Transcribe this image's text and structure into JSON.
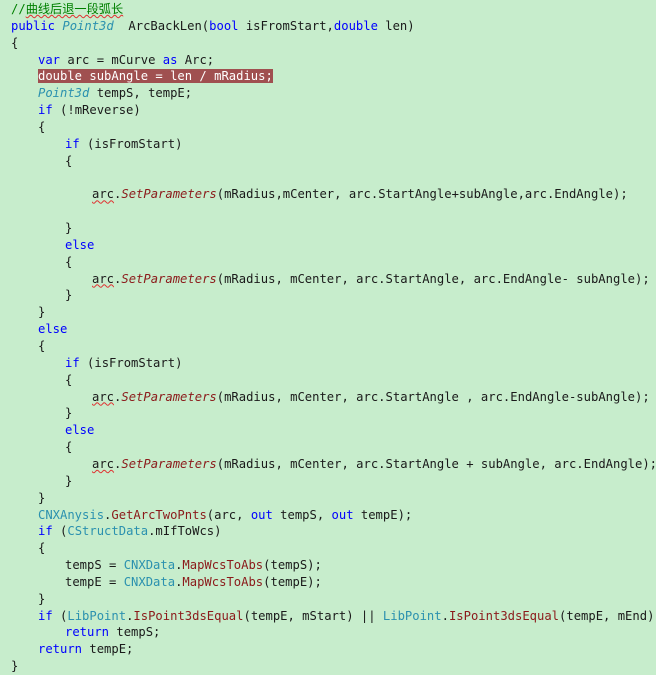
{
  "editor": {
    "lines": [
      {
        "indent": 0,
        "tokens": [
          {
            "t": "//",
            "c": "cmt"
          },
          {
            "t": "曲线后退一段弧长",
            "c": "cmt squig"
          }
        ]
      },
      {
        "indent": 0,
        "tokens": [
          {
            "t": "public ",
            "c": "kw"
          },
          {
            "t": "Point3d",
            "c": "type"
          },
          {
            "t": "  ArcBackLen(",
            "c": "txt"
          },
          {
            "t": "bool",
            "c": "kw"
          },
          {
            "t": " isFromStart,",
            "c": "txt"
          },
          {
            "t": "double",
            "c": "kw"
          },
          {
            "t": " len)",
            "c": "txt"
          }
        ]
      },
      {
        "indent": 0,
        "tokens": [
          {
            "t": "{",
            "c": "txt"
          }
        ]
      },
      {
        "indent": 4,
        "tokens": [
          {
            "t": "var",
            "c": "kw"
          },
          {
            "t": " arc = mCurve ",
            "c": "txt"
          },
          {
            "t": "as",
            "c": "kw"
          },
          {
            "t": " Arc;",
            "c": "txt"
          }
        ]
      },
      {
        "indent": 4,
        "selected": true,
        "tokens": [
          {
            "t": "double",
            "c": "kw"
          },
          {
            "t": " subAngle = len / mRadius;",
            "c": "txt"
          }
        ]
      },
      {
        "indent": 4,
        "tokens": [
          {
            "t": "Point3d",
            "c": "type"
          },
          {
            "t": " tempS, tempE;",
            "c": "txt"
          }
        ]
      },
      {
        "indent": 4,
        "tokens": [
          {
            "t": "if",
            "c": "kw"
          },
          {
            "t": " (!mReverse)",
            "c": "txt"
          }
        ]
      },
      {
        "indent": 4,
        "tokens": [
          {
            "t": "{",
            "c": "txt"
          }
        ]
      },
      {
        "indent": 8,
        "tokens": [
          {
            "t": "if",
            "c": "kw"
          },
          {
            "t": " (isFromStart)",
            "c": "txt"
          }
        ]
      },
      {
        "indent": 8,
        "tokens": [
          {
            "t": "{",
            "c": "txt"
          }
        ]
      },
      {
        "indent": 0,
        "tokens": [
          {
            "t": "",
            "c": "txt"
          }
        ]
      },
      {
        "indent": 12,
        "tokens": [
          {
            "t": "arc",
            "c": "txt squig"
          },
          {
            "t": ".",
            "c": "txt"
          },
          {
            "t": "SetParameters",
            "c": "method"
          },
          {
            "t": "(mRadius,mCenter, arc.",
            "c": "txt"
          },
          {
            "t": "StartAngle",
            "c": "txt"
          },
          {
            "t": "+subAngle,arc.",
            "c": "txt"
          },
          {
            "t": "EndAngle",
            "c": "txt"
          },
          {
            "t": ");",
            "c": "txt"
          }
        ]
      },
      {
        "indent": 0,
        "tokens": [
          {
            "t": "",
            "c": "txt"
          }
        ]
      },
      {
        "indent": 8,
        "tokens": [
          {
            "t": "}",
            "c": "txt"
          }
        ]
      },
      {
        "indent": 8,
        "tokens": [
          {
            "t": "else",
            "c": "kw"
          }
        ]
      },
      {
        "indent": 8,
        "tokens": [
          {
            "t": "{",
            "c": "txt"
          }
        ]
      },
      {
        "indent": 12,
        "tokens": [
          {
            "t": "arc",
            "c": "txt squig"
          },
          {
            "t": ".",
            "c": "txt"
          },
          {
            "t": "SetParameters",
            "c": "method"
          },
          {
            "t": "(mRadius, mCenter, arc.",
            "c": "txt"
          },
          {
            "t": "StartAngle",
            "c": "txt"
          },
          {
            "t": ", arc.",
            "c": "txt"
          },
          {
            "t": "EndAngle",
            "c": "txt"
          },
          {
            "t": "- subAngle);",
            "c": "txt"
          }
        ]
      },
      {
        "indent": 8,
        "tokens": [
          {
            "t": "}",
            "c": "txt"
          }
        ]
      },
      {
        "indent": 4,
        "tokens": [
          {
            "t": "}",
            "c": "txt"
          }
        ]
      },
      {
        "indent": 4,
        "tokens": [
          {
            "t": "else",
            "c": "kw"
          }
        ]
      },
      {
        "indent": 4,
        "tokens": [
          {
            "t": "{",
            "c": "txt"
          }
        ]
      },
      {
        "indent": 8,
        "tokens": [
          {
            "t": "if",
            "c": "kw"
          },
          {
            "t": " (isFromStart)",
            "c": "txt"
          }
        ]
      },
      {
        "indent": 8,
        "tokens": [
          {
            "t": "{",
            "c": "txt"
          }
        ]
      },
      {
        "indent": 12,
        "tokens": [
          {
            "t": "arc",
            "c": "txt squig"
          },
          {
            "t": ".",
            "c": "txt"
          },
          {
            "t": "SetParameters",
            "c": "method"
          },
          {
            "t": "(mRadius, mCenter, arc.",
            "c": "txt"
          },
          {
            "t": "StartAngle",
            "c": "txt"
          },
          {
            "t": " , arc.",
            "c": "txt"
          },
          {
            "t": "EndAngle",
            "c": "txt"
          },
          {
            "t": "-subAngle);",
            "c": "txt"
          }
        ]
      },
      {
        "indent": 8,
        "tokens": [
          {
            "t": "}",
            "c": "txt"
          }
        ]
      },
      {
        "indent": 8,
        "tokens": [
          {
            "t": "else",
            "c": "kw"
          }
        ]
      },
      {
        "indent": 8,
        "tokens": [
          {
            "t": "{",
            "c": "txt"
          }
        ]
      },
      {
        "indent": 12,
        "tokens": [
          {
            "t": "arc",
            "c": "txt squig"
          },
          {
            "t": ".",
            "c": "txt"
          },
          {
            "t": "SetParameters",
            "c": "method"
          },
          {
            "t": "(mRadius, mCenter, arc.",
            "c": "txt"
          },
          {
            "t": "StartAngle",
            "c": "txt"
          },
          {
            "t": " + subAngle, arc.",
            "c": "txt"
          },
          {
            "t": "EndAngle",
            "c": "txt"
          },
          {
            "t": ");",
            "c": "txt"
          }
        ]
      },
      {
        "indent": 8,
        "tokens": [
          {
            "t": "}",
            "c": "txt"
          }
        ]
      },
      {
        "indent": 4,
        "tokens": [
          {
            "t": "}",
            "c": "txt"
          }
        ]
      },
      {
        "indent": 4,
        "tokens": [
          {
            "t": "CNXAnysis",
            "c": "typen"
          },
          {
            "t": ".",
            "c": "txt"
          },
          {
            "t": "GetArcTwoPnts",
            "c": "methodn"
          },
          {
            "t": "(arc, ",
            "c": "txt"
          },
          {
            "t": "out",
            "c": "kw"
          },
          {
            "t": " tempS, ",
            "c": "txt"
          },
          {
            "t": "out",
            "c": "kw"
          },
          {
            "t": " tempE);",
            "c": "txt"
          }
        ]
      },
      {
        "indent": 4,
        "tokens": [
          {
            "t": "if",
            "c": "kw"
          },
          {
            "t": " (",
            "c": "txt"
          },
          {
            "t": "CStructData",
            "c": "typen"
          },
          {
            "t": ".mIfToWcs)",
            "c": "txt"
          }
        ]
      },
      {
        "indent": 4,
        "tokens": [
          {
            "t": "{",
            "c": "txt"
          }
        ]
      },
      {
        "indent": 8,
        "tokens": [
          {
            "t": "tempS = ",
            "c": "txt"
          },
          {
            "t": "CNXData",
            "c": "typen"
          },
          {
            "t": ".",
            "c": "txt"
          },
          {
            "t": "MapWcsToAbs",
            "c": "methodn"
          },
          {
            "t": "(tempS);",
            "c": "txt"
          }
        ]
      },
      {
        "indent": 8,
        "tokens": [
          {
            "t": "tempE = ",
            "c": "txt"
          },
          {
            "t": "CNXData",
            "c": "typen"
          },
          {
            "t": ".",
            "c": "txt"
          },
          {
            "t": "MapWcsToAbs",
            "c": "methodn"
          },
          {
            "t": "(tempE);",
            "c": "txt"
          }
        ]
      },
      {
        "indent": 4,
        "tokens": [
          {
            "t": "}",
            "c": "txt"
          }
        ]
      },
      {
        "indent": 4,
        "tokens": [
          {
            "t": "if",
            "c": "kw"
          },
          {
            "t": " (",
            "c": "txt"
          },
          {
            "t": "LibPoint",
            "c": "typen"
          },
          {
            "t": ".",
            "c": "txt"
          },
          {
            "t": "IsPoint3dsEqual",
            "c": "methodn"
          },
          {
            "t": "(tempE, mStart) || ",
            "c": "txt"
          },
          {
            "t": "LibPoint",
            "c": "typen"
          },
          {
            "t": ".",
            "c": "txt"
          },
          {
            "t": "IsPoint3dsEqual",
            "c": "methodn"
          },
          {
            "t": "(tempE, mEnd))",
            "c": "txt"
          }
        ]
      },
      {
        "indent": 8,
        "tokens": [
          {
            "t": "return",
            "c": "kw"
          },
          {
            "t": " tempS;",
            "c": "txt"
          }
        ]
      },
      {
        "indent": 4,
        "tokens": [
          {
            "t": "return",
            "c": "kw"
          },
          {
            "t": " tempE;",
            "c": "txt"
          }
        ]
      },
      {
        "indent": 0,
        "tokens": [
          {
            "t": "}",
            "c": "txt"
          }
        ]
      }
    ]
  }
}
